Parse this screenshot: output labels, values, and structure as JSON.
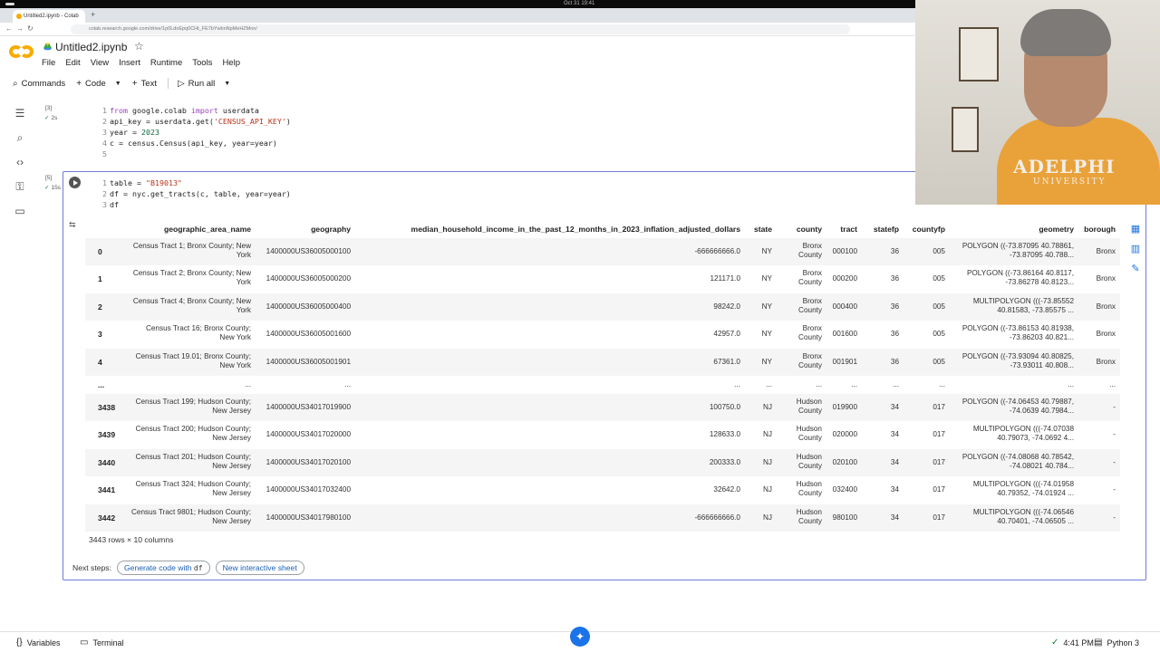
{
  "os": {
    "clock": "Oct 31 19:41"
  },
  "browser": {
    "tab_title": "Untitled2.ipynb - Colab",
    "url": "colab.research.google.com/drive/1p0LdoEpq0CHt_FE7bYwbnNpMeHZMnn/"
  },
  "notebook": {
    "title": "Untitled2.ipynb",
    "menu": [
      "File",
      "Edit",
      "View",
      "Insert",
      "Runtime",
      "Tools",
      "Help"
    ],
    "toolbar": {
      "commands": "Commands",
      "code": "Code",
      "text": "Text",
      "run_all": "Run all"
    }
  },
  "cell1": {
    "exec_count": "[3]",
    "exec_time": "2s",
    "line_numbers": [
      "1",
      "2",
      "3",
      "4",
      "5"
    ]
  },
  "cell2": {
    "exec_count": "[5]",
    "exec_time": "15s",
    "line_numbers": [
      "1",
      "2",
      "3"
    ]
  },
  "dataframe": {
    "columns": [
      "geographic_area_name",
      "geography",
      "median_household_income_in_the_past_12_months_in_2023_inflation_adjusted_dollars",
      "state",
      "county",
      "tract",
      "statefp",
      "countyfp",
      "geometry",
      "borough"
    ],
    "rows": [
      {
        "idx": "0",
        "area1": "Census Tract 1; Bronx County; New",
        "area2": "York",
        "geography": "1400000US36005000100",
        "income": "-666666666.0",
        "state": "NY",
        "county1": "Bronx",
        "county2": "County",
        "tract": "000100",
        "statefp": "36",
        "countyfp": "005",
        "geom1": "POLYGON ((-73.87095 40.78861,",
        "geom2": "-73.87095 40.788...",
        "borough": "Bronx"
      },
      {
        "idx": "1",
        "area1": "Census Tract 2; Bronx County; New",
        "area2": "York",
        "geography": "1400000US36005000200",
        "income": "121171.0",
        "state": "NY",
        "county1": "Bronx",
        "county2": "County",
        "tract": "000200",
        "statefp": "36",
        "countyfp": "005",
        "geom1": "POLYGON ((-73.86164 40.8117,",
        "geom2": "-73.86278 40.8123...",
        "borough": "Bronx"
      },
      {
        "idx": "2",
        "area1": "Census Tract 4; Bronx County; New",
        "area2": "York",
        "geography": "1400000US36005000400",
        "income": "98242.0",
        "state": "NY",
        "county1": "Bronx",
        "county2": "County",
        "tract": "000400",
        "statefp": "36",
        "countyfp": "005",
        "geom1": "MULTIPOLYGON (((-73.85552",
        "geom2": "40.81583, -73.85575 ...",
        "borough": "Bronx"
      },
      {
        "idx": "3",
        "area1": "Census Tract 16; Bronx County;",
        "area2": "New York",
        "geography": "1400000US36005001600",
        "income": "42957.0",
        "state": "NY",
        "county1": "Bronx",
        "county2": "County",
        "tract": "001600",
        "statefp": "36",
        "countyfp": "005",
        "geom1": "POLYGON ((-73.86153 40.81938,",
        "geom2": "-73.86203 40.821...",
        "borough": "Bronx"
      },
      {
        "idx": "4",
        "area1": "Census Tract 19.01; Bronx County;",
        "area2": "New York",
        "geography": "1400000US36005001901",
        "income": "67361.0",
        "state": "NY",
        "county1": "Bronx",
        "county2": "County",
        "tract": "001901",
        "statefp": "36",
        "countyfp": "005",
        "geom1": "POLYGON ((-73.93094 40.80825,",
        "geom2": "-73.93011 40.808...",
        "borough": "Bronx"
      },
      {
        "idx": "...",
        "area1": "...",
        "area2": "",
        "geography": "...",
        "income": "...",
        "state": "...",
        "county1": "...",
        "county2": "",
        "tract": "...",
        "statefp": "...",
        "countyfp": "...",
        "geom1": "...",
        "geom2": "",
        "borough": "..."
      },
      {
        "idx": "3438",
        "area1": "Census Tract 199; Hudson County;",
        "area2": "New Jersey",
        "geography": "1400000US34017019900",
        "income": "100750.0",
        "state": "NJ",
        "county1": "Hudson",
        "county2": "County",
        "tract": "019900",
        "statefp": "34",
        "countyfp": "017",
        "geom1": "POLYGON ((-74.06453 40.79887,",
        "geom2": "-74.0639 40.7984...",
        "borough": "-"
      },
      {
        "idx": "3439",
        "area1": "Census Tract 200; Hudson County;",
        "area2": "New Jersey",
        "geography": "1400000US34017020000",
        "income": "128633.0",
        "state": "NJ",
        "county1": "Hudson",
        "county2": "County",
        "tract": "020000",
        "statefp": "34",
        "countyfp": "017",
        "geom1": "MULTIPOLYGON (((-74.07038",
        "geom2": "40.79073, -74.0692 4...",
        "borough": "-"
      },
      {
        "idx": "3440",
        "area1": "Census Tract 201; Hudson County;",
        "area2": "New Jersey",
        "geography": "1400000US34017020100",
        "income": "200333.0",
        "state": "NJ",
        "county1": "Hudson",
        "county2": "County",
        "tract": "020100",
        "statefp": "34",
        "countyfp": "017",
        "geom1": "POLYGON ((-74.08068 40.78542,",
        "geom2": "-74.08021 40.784...",
        "borough": "-"
      },
      {
        "idx": "3441",
        "area1": "Census Tract 324; Hudson County;",
        "area2": "New Jersey",
        "geography": "1400000US34017032400",
        "income": "32642.0",
        "state": "NJ",
        "county1": "Hudson",
        "county2": "County",
        "tract": "032400",
        "statefp": "34",
        "countyfp": "017",
        "geom1": "MULTIPOLYGON (((-74.01958",
        "geom2": "40.79352, -74.01924 ...",
        "borough": "-"
      },
      {
        "idx": "3442",
        "area1": "Census Tract 9801; Hudson County;",
        "area2": "New Jersey",
        "geography": "1400000US34017980100",
        "income": "-666666666.0",
        "state": "NJ",
        "county1": "Hudson",
        "county2": "County",
        "tract": "980100",
        "statefp": "34",
        "countyfp": "017",
        "geom1": "MULTIPOLYGON (((-74.06546",
        "geom2": "40.70401, -74.06505 ...",
        "borough": "-"
      }
    ],
    "shape_text": "3443 rows × 10 columns"
  },
  "next_steps": {
    "label": "Next steps:",
    "generate_prefix": "Generate code with",
    "generate_var": "df",
    "new_sheet": "New interactive sheet"
  },
  "statusbar": {
    "variables": "Variables",
    "terminal": "Terminal",
    "time": "4:41 PM",
    "kernel": "Python 3"
  },
  "webcam": {
    "shirt_text": "ADELPHI",
    "shirt_text2": "UNIVERSITY"
  },
  "colors": {
    "accent": "#1a73e8",
    "cell_border": "#6f7bd6",
    "colab_orange": "#f9ab00"
  }
}
